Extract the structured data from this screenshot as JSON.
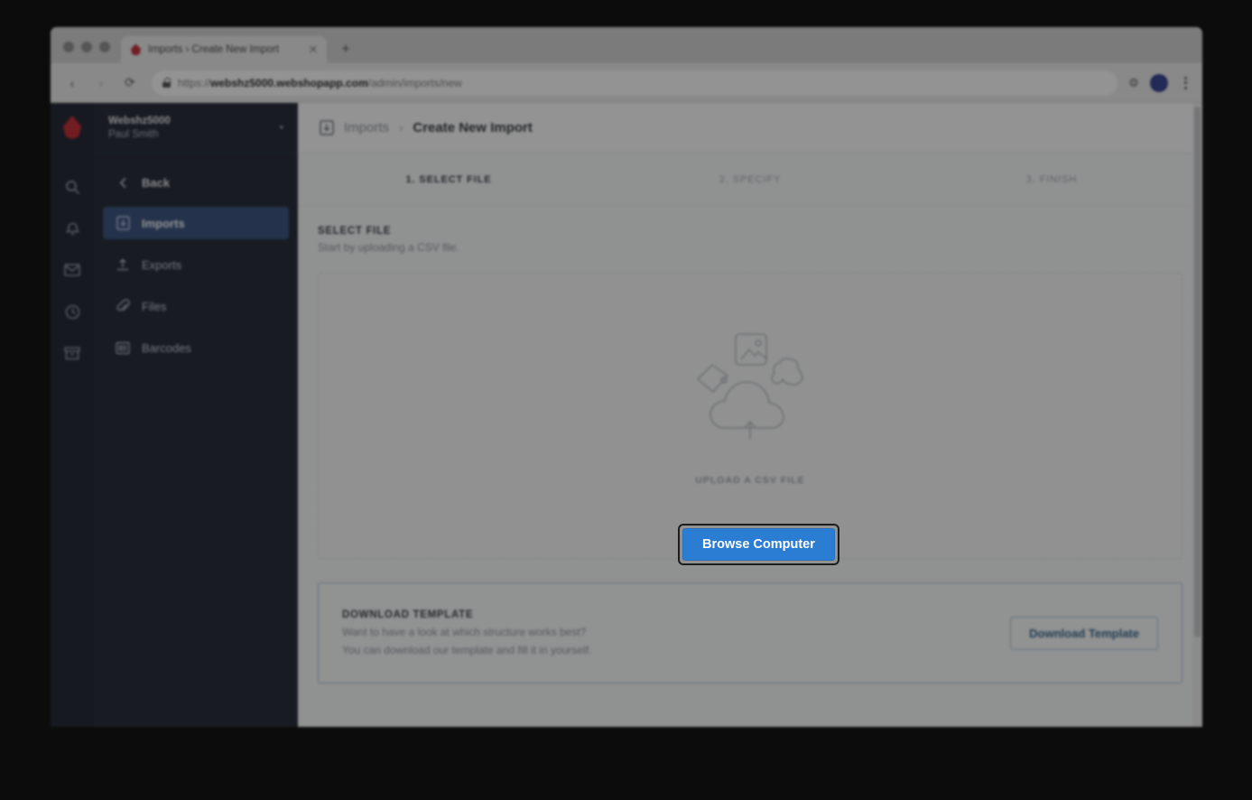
{
  "browser": {
    "tab": {
      "title": "Imports › Create New Import",
      "favicon": "shop-logo-icon",
      "close": "×"
    },
    "new_tab_label": "+",
    "nav": {
      "back": "‹",
      "forward": "›",
      "reload": "⟳"
    },
    "url": {
      "scheme": "https://",
      "host": "webshz5000.webshopapp.com",
      "path": "/admin/imports/new",
      "lock": "lock-icon"
    },
    "extensions_label": "⚙",
    "menu_label": "kebab-menu"
  },
  "rail": {
    "logo": "brand-drop-logo",
    "icons": [
      {
        "name": "search-icon",
        "glyph": "search"
      },
      {
        "name": "notifications-icon",
        "glyph": "bell"
      },
      {
        "name": "messages-icon",
        "glyph": "inbox"
      },
      {
        "name": "activity-icon",
        "glyph": "clock"
      },
      {
        "name": "archive-icon",
        "glyph": "box"
      }
    ]
  },
  "sidebar": {
    "store_name": "Webshz5000",
    "user_name": "Paul Smith",
    "caret": "▾",
    "back_label": "Back",
    "items": [
      {
        "label": "Imports",
        "icon": "import-icon",
        "active": true
      },
      {
        "label": "Exports",
        "icon": "export-icon",
        "active": false
      },
      {
        "label": "Files",
        "icon": "paperclip-icon",
        "active": false
      },
      {
        "label": "Barcodes",
        "icon": "barcode-icon",
        "active": false
      }
    ]
  },
  "breadcrumb": {
    "icon": "import-icon",
    "parent": "Imports",
    "separator": "›",
    "current": "Create New Import"
  },
  "steps": [
    {
      "label": "1. SELECT FILE",
      "active": true
    },
    {
      "label": "2. SPECIFY",
      "active": false
    },
    {
      "label": "3. FINISH",
      "active": false
    }
  ],
  "select_file": {
    "title": "SELECT FILE",
    "subtitle": "Start by uploading a CSV file.",
    "dropzone_label": "UPLOAD A CSV FILE",
    "browse_button": "Browse Computer"
  },
  "download_template": {
    "title": "DOWNLOAD TEMPLATE",
    "line1": "Want to have a look at which structure works best?",
    "line2": "You can download our template and fill it in yourself.",
    "button": "Download Template"
  },
  "colors": {
    "accent_blue": "#2b7cd3",
    "sidebar_bg": "#171e2b",
    "rail_bg": "#141b26",
    "active_nav": "#2f4a78",
    "brand_red": "#c0202a",
    "template_border": "#9fc3d8"
  }
}
